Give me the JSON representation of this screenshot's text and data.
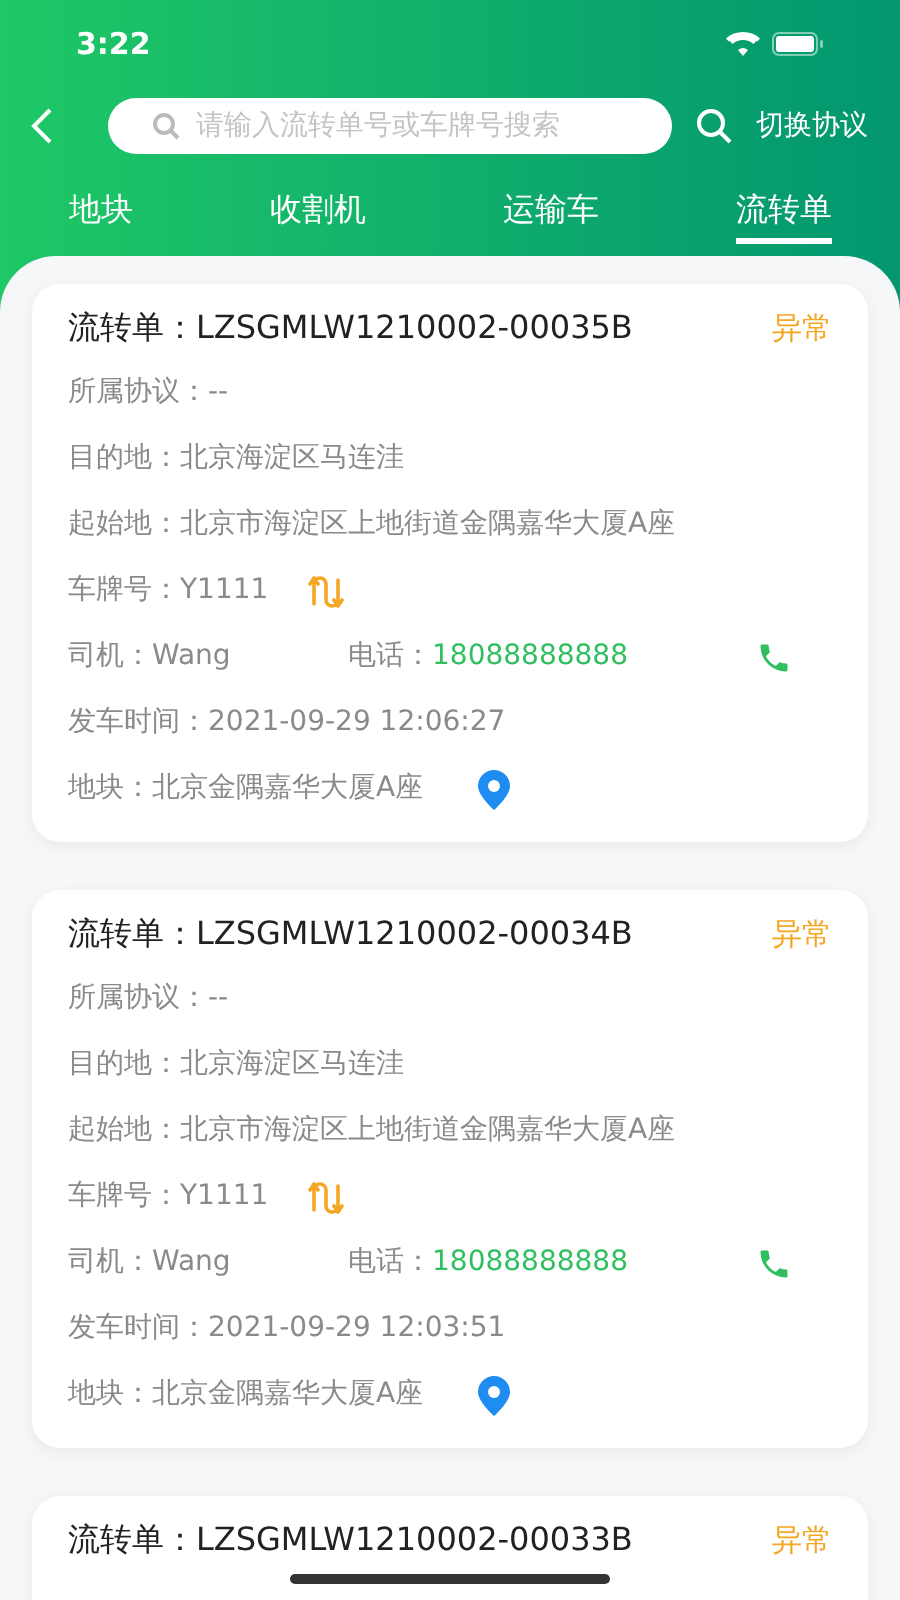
{
  "status_bar": {
    "time": "3:22"
  },
  "search": {
    "placeholder": "请输入流转单号或车牌号搜索",
    "action": "切换协议"
  },
  "tabs": [
    {
      "label": "地块",
      "selected": false
    },
    {
      "label": "收割机",
      "selected": false
    },
    {
      "label": "运输车",
      "selected": false
    },
    {
      "label": "流转单",
      "selected": true
    }
  ],
  "cards": [
    {
      "title_label": "流转单：",
      "number": "LZSGMLW1210002-00035B",
      "status": "异常",
      "fields": [
        {
          "kind": "text",
          "label": "所属协议：",
          "value": "--"
        },
        {
          "kind": "text",
          "label": "目的地：",
          "value": "北京海淀区马连洼"
        },
        {
          "kind": "text",
          "label": "起始地：",
          "value": "北京市海淀区上地街道金隅嘉华大厦A座"
        },
        {
          "kind": "plate",
          "label": "车牌号：",
          "value": "Y1111"
        },
        {
          "kind": "driver",
          "label": "司机：",
          "value": "Wang",
          "phone_label": "电话：",
          "phone": "18088888888"
        },
        {
          "kind": "text",
          "label": "发车时间：",
          "value": "2021-09-29 12:06:27"
        },
        {
          "kind": "location",
          "label": "地块：",
          "value": "北京金隅嘉华大厦A座"
        }
      ]
    },
    {
      "title_label": "流转单：",
      "number": "LZSGMLW1210002-00034B",
      "status": "异常",
      "fields": [
        {
          "kind": "text",
          "label": "所属协议：",
          "value": "--"
        },
        {
          "kind": "text",
          "label": "目的地：",
          "value": "北京海淀区马连洼"
        },
        {
          "kind": "text",
          "label": "起始地：",
          "value": "北京市海淀区上地街道金隅嘉华大厦A座"
        },
        {
          "kind": "plate",
          "label": "车牌号：",
          "value": "Y1111"
        },
        {
          "kind": "driver",
          "label": "司机：",
          "value": "Wang",
          "phone_label": "电话：",
          "phone": "18088888888"
        },
        {
          "kind": "text",
          "label": "发车时间：",
          "value": "2021-09-29 12:03:51"
        },
        {
          "kind": "location",
          "label": "地块：",
          "value": "北京金隅嘉华大厦A座"
        }
      ]
    },
    {
      "title_label": "流转单：",
      "number": "LZSGMLW1210002-00033B",
      "status": "异常"
    }
  ]
}
